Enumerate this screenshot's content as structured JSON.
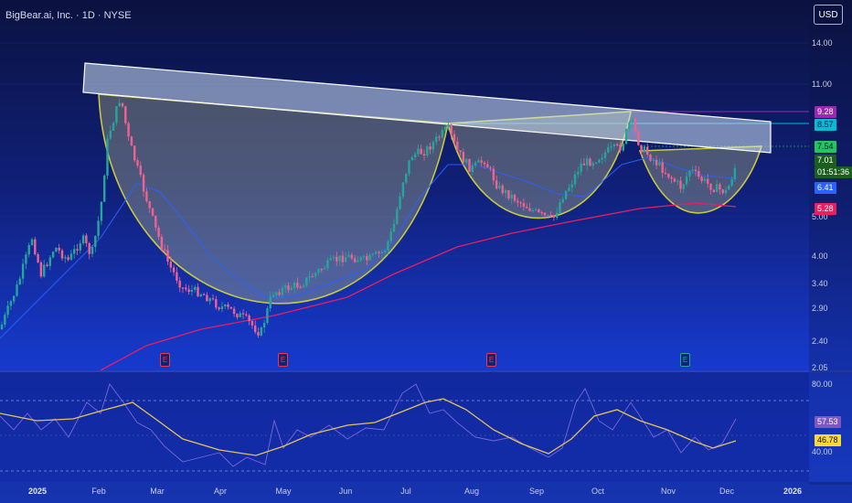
{
  "header": {
    "title": "BigBear.ai, Inc. · 1D · NYSE",
    "currency": "USD"
  },
  "price_axis": [
    "14.00",
    "11.00",
    "4.00",
    "3.40",
    "2.90",
    "2.40",
    "2.05"
  ],
  "price_axis_partial": "5.00",
  "price_badges": [
    {
      "key": "top",
      "value": "9.28",
      "bg": "#9c27b0",
      "fg": "#ffffff"
    },
    {
      "key": "mid",
      "value": "8.57",
      "bg": "#00bcd4",
      "fg": "#0b1240"
    },
    {
      "key": "last",
      "value": "7.54",
      "bg": "#22c55e",
      "fg": "#0b1240"
    },
    {
      "key": "close",
      "value": "7.01",
      "bg": "#1b5e20",
      "fg": "#ffffff"
    },
    {
      "key": "countdown",
      "value": "01:51:36",
      "bg": "#1b5e20",
      "fg": "#ffffff"
    },
    {
      "key": "ma_fast",
      "value": "6.41",
      "bg": "#2962ff",
      "fg": "#ffffff"
    },
    {
      "key": "ma_slow",
      "value": "5.28",
      "bg": "#e91e63",
      "fg": "#ffffff"
    }
  ],
  "oscillator": {
    "axis": [
      "80.00",
      "40.00"
    ],
    "badges": [
      {
        "key": "rsi",
        "value": "57.53",
        "bg": "#7e57c2",
        "fg": "#ffffff"
      },
      {
        "key": "rsi_ma",
        "value": "46.78",
        "bg": "#fdd835",
        "fg": "#0b1240"
      }
    ]
  },
  "time_axis": [
    {
      "label": "2025",
      "bold": true
    },
    {
      "label": "Feb"
    },
    {
      "label": "Mar"
    },
    {
      "label": "Apr"
    },
    {
      "label": "May"
    },
    {
      "label": "Jun"
    },
    {
      "label": "Jul"
    },
    {
      "label": "Aug"
    },
    {
      "label": "Sep"
    },
    {
      "label": "Oct"
    },
    {
      "label": "Nov"
    },
    {
      "label": "Dec"
    },
    {
      "label": "2026",
      "bold": true
    }
  ],
  "earnings_markers": [
    {
      "label": "E",
      "status": "past"
    },
    {
      "label": "E",
      "status": "past"
    },
    {
      "label": "E",
      "status": "past"
    },
    {
      "label": "E",
      "status": "upcoming"
    }
  ],
  "colors": {
    "up": "#26a69a",
    "down": "#f06292",
    "ma_fast": "#2962ff",
    "ma_slow": "#e91e63",
    "cup_outline": "#c8c83c",
    "resistance_band": "#cfe3f5",
    "rsi": "#7e6cd8",
    "rsi_ma": "#e6c35a"
  }
}
